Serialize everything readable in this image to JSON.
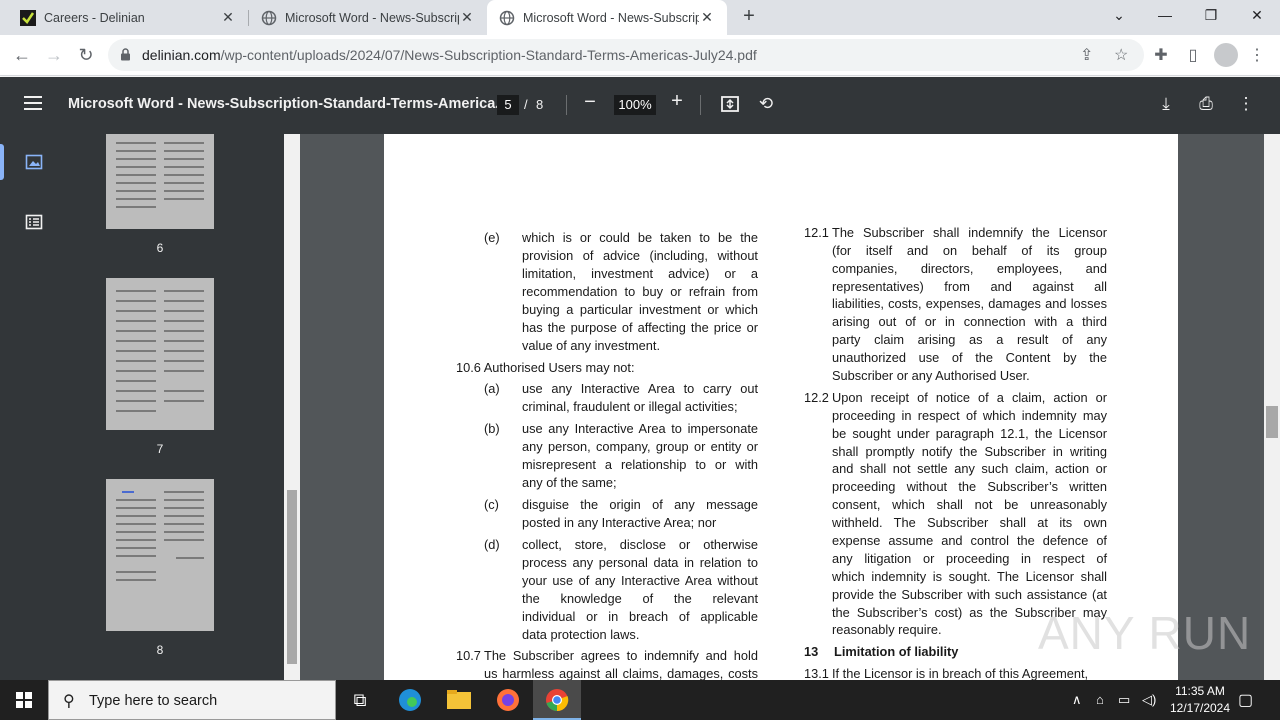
{
  "browser": {
    "tabs": [
      {
        "title": "Careers - Delinian",
        "active": false
      },
      {
        "title": "Microsoft Word - News-Subscrip",
        "active": false
      },
      {
        "title": "Microsoft Word - News-Subscrip",
        "active": true
      }
    ],
    "url_host": "delinian.com",
    "url_path": "/wp-content/uploads/2024/07/News-Subscription-Standard-Terms-Americas-July24.pdf"
  },
  "pdf_toolbar": {
    "title": "Microsoft Word - News-Subscription-Standard-Terms-America...",
    "current_page": "5",
    "separator": "/",
    "total_pages": "8",
    "zoom": "100%"
  },
  "thumbnails": [
    {
      "label": "6"
    },
    {
      "label": "7"
    },
    {
      "label": "8"
    }
  ],
  "document": {
    "left_column": {
      "item_e_label": "(e)",
      "item_e_lines": [
        "which is or could be taken to be the",
        "provision of advice (including, without",
        "limitation, investment advice) or a",
        "recommendation to buy or refrain from",
        "buying a particular investment or which",
        "has the purpose of affecting the price or",
        "value of any investment."
      ],
      "clause_10_6": "10.6 Authorised Users may not:",
      "item_a_label": "(a)",
      "item_a_lines": [
        "use any Interactive Area to carry out",
        "criminal, fraudulent or illegal activities;"
      ],
      "item_b_label": "(b)",
      "item_b_lines": [
        "use any Interactive Area to impersonate",
        "any person, company, group or entity or",
        "misrepresent a relationship to or with",
        "any of the same;"
      ],
      "item_c_label": "(c)",
      "item_c_lines": [
        "disguise the origin of any message",
        "posted in any Interactive Area; nor"
      ],
      "item_d_label": "(d)",
      "item_d_lines": [
        "collect, store, disclose or otherwise",
        "process any personal data in relation to",
        "your use of any Interactive Area without",
        "the knowledge of the relevant",
        "individual or in breach of applicable",
        "data protection laws."
      ],
      "clause_10_7_num": "10.7",
      "clause_10_7_lines": [
        "The Subscriber agrees to indemnify and hold",
        "us harmless against all claims, damages, costs"
      ]
    },
    "right_column": {
      "clause_12_1_num": "12.1",
      "clause_12_1_lines": [
        "The Subscriber shall indemnify the Licensor",
        "(for itself and on behalf of its group",
        "companies, directors, employees, and",
        "representatives) from and against all",
        "liabilities, costs, expenses, damages and losses",
        "arising out of or in connection with a third",
        "party claim arising as a result of any",
        "unauthorized use of the Content by the",
        "Subscriber or any Authorised User."
      ],
      "clause_12_2_num": "12.2",
      "clause_12_2_lines": [
        "Upon receipt of notice of a claim, action or",
        "proceeding in respect of which indemnity may",
        "be sought under paragraph 12.1, the Licensor",
        "shall promptly notify the Subscriber in writing",
        "and shall not settle any such claim, action or",
        "proceeding without the Subscriber’s written",
        "consent, which shall not be unreasonably",
        "withheld.  The Subscriber shall at its own",
        "expense assume and control the defence of",
        "any litigation or proceeding in respect of",
        "which indemnity is sought.  The Licensor shall",
        "provide the Subscriber with such assistance (at",
        "the Subscriber’s cost) as the Subscriber may",
        "reasonably require."
      ],
      "section_13_num": "13",
      "section_13_title": "Limitation of liability",
      "clause_13_1_num": "13.1",
      "clause_13_1_line": "If the Licensor is in breach of this Agreement,"
    }
  },
  "watermark": "ANY RUN",
  "taskbar": {
    "search_placeholder": "Type here to search",
    "time": "11:35 AM",
    "date": "12/17/2024"
  },
  "colors": {
    "pdf_toolbar": "#323639",
    "viewer_bg": "#525659",
    "tabstrip": "#dee1e6",
    "taskbar": "#202020"
  }
}
